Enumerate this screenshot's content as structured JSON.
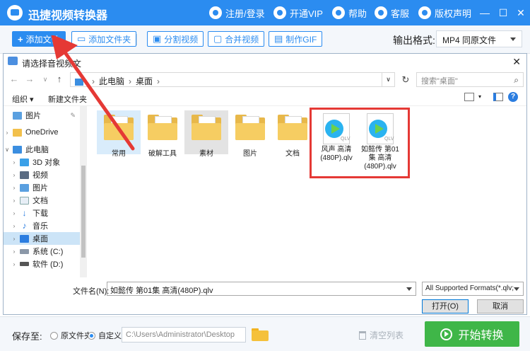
{
  "app": {
    "title": "迅捷视频转换器",
    "top_nav": [
      "注册/登录",
      "开通VIP",
      "帮助",
      "客服",
      "版权声明"
    ],
    "window_controls": [
      "—",
      "☐",
      "✕"
    ],
    "brand_color": "#2b8cf0"
  },
  "toolbar": {
    "add_file": "添加文件",
    "add_folder": "添加文件夹",
    "split_video": "分割视频",
    "merge_video": "合并视频",
    "make_gif": "制作GIF",
    "output_format_label": "输出格式:",
    "output_format_value": "MP4   同原文件"
  },
  "dialog": {
    "title": "请选择音视频文",
    "close": "✕",
    "breadcrumb": [
      "此电脑",
      "桌面"
    ],
    "search_placeholder": "搜索\"桌面\"",
    "organize": "组织 ▾",
    "new_folder": "新建文件夹",
    "help": "?",
    "nav_items": [
      {
        "label": "图片",
        "icon": "pictures-icon",
        "pinned": true
      },
      {
        "label": "OneDrive",
        "icon": "onedrive-folder-icon"
      },
      {
        "label": "此电脑",
        "icon": "pc-icon",
        "expanded": true
      },
      {
        "label": "3D 对象",
        "icon": "3d-objects-icon"
      },
      {
        "label": "视频",
        "icon": "videos-icon"
      },
      {
        "label": "图片",
        "icon": "pictures-icon"
      },
      {
        "label": "文档",
        "icon": "documents-icon"
      },
      {
        "label": "下载",
        "icon": "downloads-icon"
      },
      {
        "label": "音乐",
        "icon": "music-icon"
      },
      {
        "label": "桌面",
        "icon": "desktop-icon",
        "selected": true
      },
      {
        "label": "系统 (C:)",
        "icon": "drive-c-icon"
      },
      {
        "label": "软件 (D:)",
        "icon": "drive-d-icon"
      }
    ],
    "folders": [
      "常用",
      "破解工具",
      "素材",
      "图片",
      "文档"
    ],
    "video_files": [
      {
        "name": "风声 高清(480P).qlv",
        "ext": "QLV"
      },
      {
        "name": "如懿传 第01集 高清(480P).qlv",
        "ext": "QLV"
      }
    ],
    "filename_label": "文件名(N):",
    "filename_value": "如懿传 第01集 高清(480P).qlv",
    "filter_value": "All Supported Formats(*.qlv;",
    "open_button": "打开(O)",
    "cancel_button": "取消"
  },
  "bottom": {
    "save_to_label": "保存至:",
    "radio_original": "原文件夹",
    "radio_custom": "自定义",
    "custom_selected": true,
    "path_value": "C:\\Users\\Administrator\\Desktop",
    "clear_list": "清空列表",
    "start_button": "开始转换"
  }
}
